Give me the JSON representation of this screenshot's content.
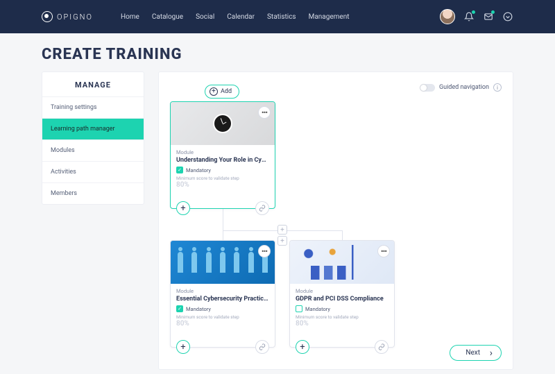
{
  "brand": "OPIGNO",
  "nav": [
    "Home",
    "Catalogue",
    "Social",
    "Calendar",
    "Statistics",
    "Management"
  ],
  "page_title": "CREATE TRAINING",
  "sidebar": {
    "title": "MANAGE",
    "items": [
      "Training settings",
      "Learning path manager",
      "Modules",
      "Activities",
      "Members"
    ],
    "active_index": 1
  },
  "canvas": {
    "add_label": "Add",
    "guided_label": "Guided navigation",
    "next_label": "Next"
  },
  "cards": [
    {
      "kicker": "Module",
      "title": "Understanding Your Role in Cybe...",
      "mandatory_label": "Mandatory",
      "mandatory_checked": true,
      "min_label": "Minimum score to validate step",
      "min_value": "80%"
    },
    {
      "kicker": "Module",
      "title": "Essential Cybersecurity Practices",
      "mandatory_label": "Mandatory",
      "mandatory_checked": true,
      "min_label": "Minimum score to validate step",
      "min_value": "80%"
    },
    {
      "kicker": "Module",
      "title": "GDPR and PCI DSS Compliance",
      "mandatory_label": "Mandatory",
      "mandatory_checked": false,
      "min_label": "Minimum score to validate step",
      "min_value": "80%"
    }
  ]
}
